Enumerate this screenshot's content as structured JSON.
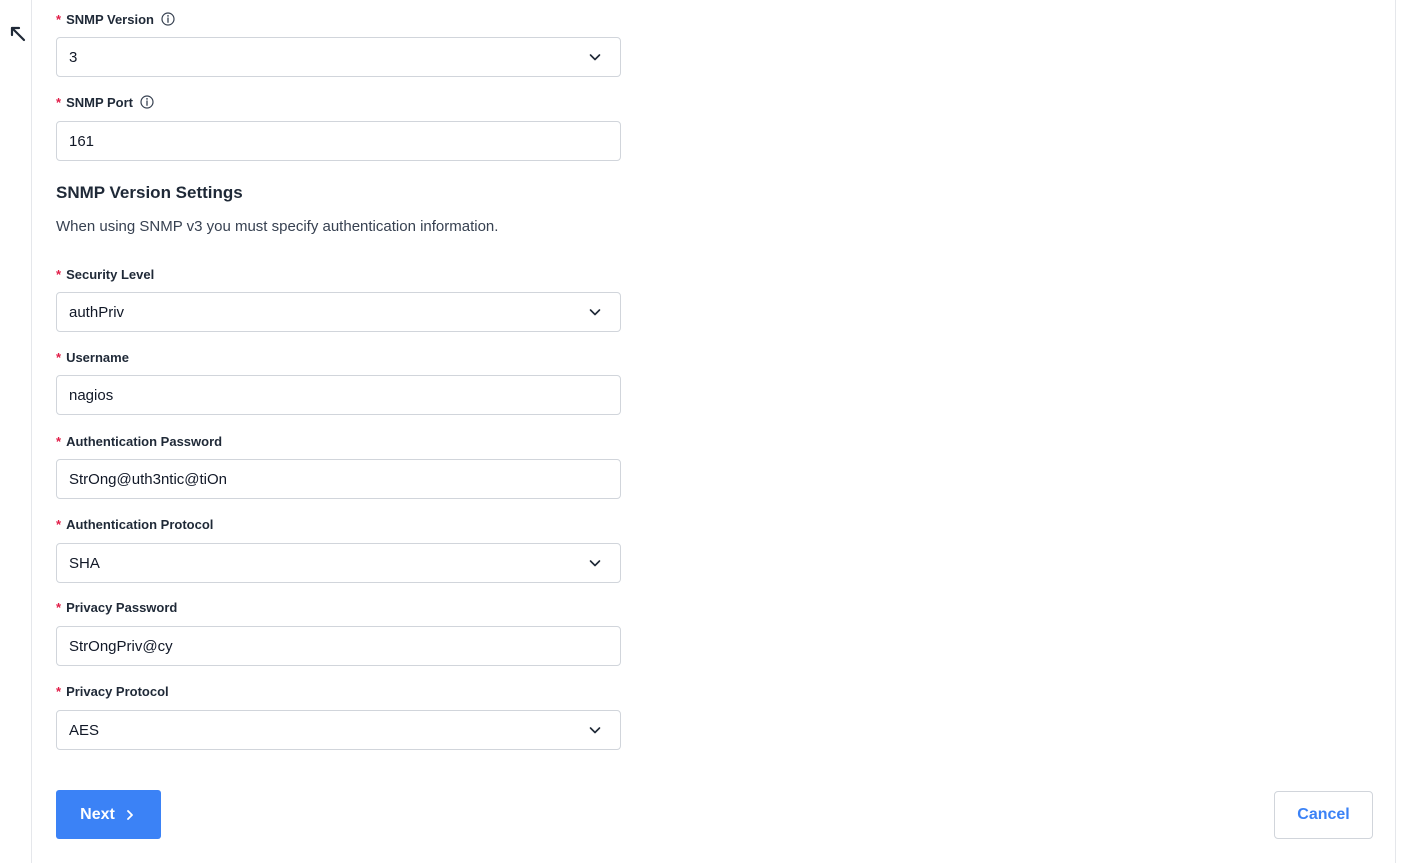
{
  "colors": {
    "accent": "#3b82f6",
    "required": "#e11d48",
    "border": "#d1d5db"
  },
  "fields": {
    "snmp_version": {
      "label": "SNMP Version",
      "value": "3",
      "icon": "info-icon"
    },
    "snmp_port": {
      "label": "SNMP Port",
      "value": "161",
      "icon": "info-icon"
    },
    "security_level": {
      "label": "Security Level",
      "value": "authPriv"
    },
    "username": {
      "label": "Username",
      "value": "nagios"
    },
    "auth_password": {
      "label": "Authentication Password",
      "value": "StrOng@uth3ntic@tiOn"
    },
    "auth_protocol": {
      "label": "Authentication Protocol",
      "value": "SHA"
    },
    "privacy_password": {
      "label": "Privacy Password",
      "value": "StrOngPriv@cy"
    },
    "privacy_protocol": {
      "label": "Privacy Protocol",
      "value": "AES"
    }
  },
  "required_marker": "*",
  "section": {
    "title": "SNMP Version Settings",
    "description": "When using SNMP v3 you must specify authentication information."
  },
  "buttons": {
    "next_label": "Next",
    "cancel_label": "Cancel"
  }
}
